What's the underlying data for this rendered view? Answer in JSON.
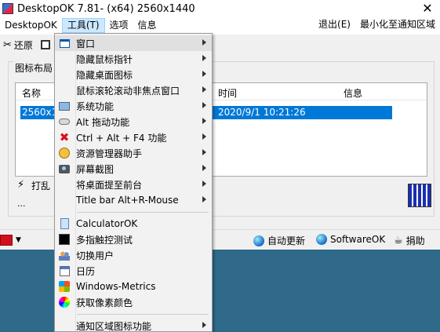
{
  "window": {
    "title": "DesktopOK 7.81- (x64) 2560x1440",
    "close_symbol": "✕"
  },
  "menubar": {
    "items": [
      "DesktopOK",
      "工具(T)",
      "选项",
      "信息"
    ],
    "right_items": [
      "退出(E)",
      "最小化至通知区域"
    ]
  },
  "toolbar": {
    "restore_label": "还原"
  },
  "layout_group": {
    "label": "图标布局",
    "columns": [
      "名称",
      "时间",
      "信息"
    ],
    "rows": [
      {
        "name": "2560x144",
        "time": "2020/9/1 10:21:26",
        "info": ""
      }
    ],
    "shuffle_label": "打乱",
    "ellipsis": "..."
  },
  "statusbar": {
    "autoupdate_label": "自动更新",
    "softwareok_label": "SoftwareOK",
    "donate_label": "捐助"
  },
  "tools_menu": {
    "items": [
      {
        "label": "窗口",
        "icon": "window-icon",
        "submenu": true
      },
      {
        "label": "隐藏鼠标指针",
        "icon": "",
        "submenu": true
      },
      {
        "label": "隐藏桌面图标",
        "icon": "",
        "submenu": true
      },
      {
        "label": "鼠标滚轮滚动非焦点窗口",
        "icon": "",
        "submenu": true
      },
      {
        "label": "系统功能",
        "icon": "system-icon",
        "submenu": true
      },
      {
        "label": "Alt 拖动功能",
        "icon": "mouse-icon",
        "submenu": true
      },
      {
        "label": "Ctrl + Alt + F4 功能",
        "icon": "red-x-icon",
        "submenu": true
      },
      {
        "label": "资源管理器助手",
        "icon": "helper-icon",
        "submenu": true
      },
      {
        "label": "屏幕截图",
        "icon": "camera-icon",
        "submenu": true
      },
      {
        "label": "将桌面提至前台",
        "icon": "",
        "submenu": true
      },
      {
        "label": "Title bar Alt+R-Mouse",
        "icon": "",
        "submenu": true
      },
      {
        "label": "CalculatorOK",
        "icon": "calculator-icon",
        "submenu": false
      },
      {
        "label": "多指触控测试",
        "icon": "touch-icon",
        "submenu": false
      },
      {
        "label": "切换用户",
        "icon": "users-icon",
        "submenu": false
      },
      {
        "label": "日历",
        "icon": "calendar-icon",
        "submenu": false
      },
      {
        "label": "Windows-Metrics",
        "icon": "windows-icon",
        "submenu": false
      },
      {
        "label": "获取像素颜色",
        "icon": "color-picker-icon",
        "submenu": false
      },
      {
        "label": "通知区域图标功能",
        "icon": "",
        "submenu": true
      }
    ]
  },
  "colors": {
    "selection": "#0078d7",
    "desktop": "#2f6a8a",
    "menu_active": "#cce8ff"
  }
}
